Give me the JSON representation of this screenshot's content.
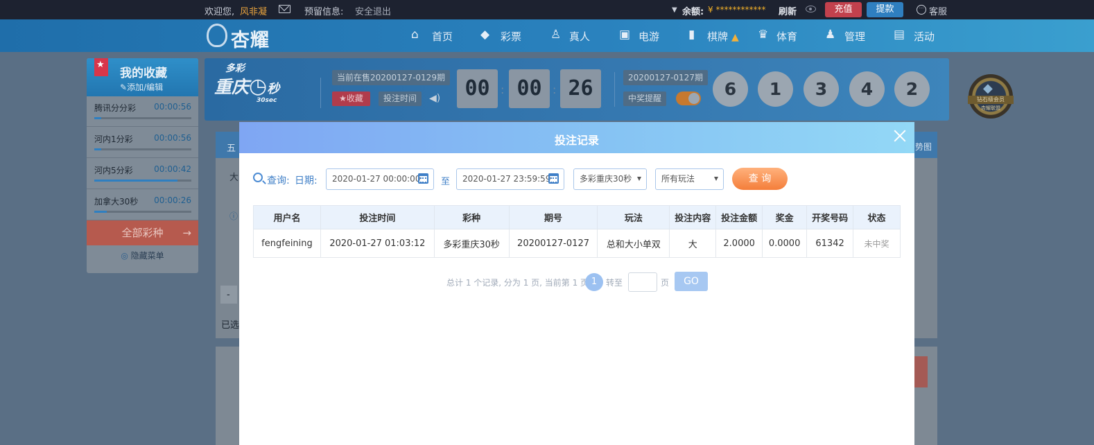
{
  "topbar": {
    "welcome": "欢迎您,",
    "username": "风非凝",
    "reserved_info": "预留信息:",
    "logout": "安全退出",
    "balance_label": "余额:",
    "balance_value": "¥ ************",
    "refresh": "刷新",
    "recharge": "充值",
    "withdraw": "提款",
    "service": "客服"
  },
  "nav": {
    "logo": "杏耀",
    "items": [
      {
        "label": "首页",
        "icon": "home-icon"
      },
      {
        "label": "彩票",
        "icon": "lottery-icon"
      },
      {
        "label": "真人",
        "icon": "live-dealer-icon"
      },
      {
        "label": "电游",
        "icon": "slot-machine-icon"
      },
      {
        "label": "棋牌",
        "icon": "cards-icon"
      },
      {
        "label": "体育",
        "icon": "trophy-icon"
      },
      {
        "label": "管理",
        "icon": "users-icon"
      },
      {
        "label": "活动",
        "icon": "gift-icon"
      }
    ]
  },
  "favorites": {
    "title": "我的收藏",
    "edit": "添加/编辑",
    "items": [
      {
        "name": "腾讯分分彩",
        "time": "00:00:56",
        "progress": 0.07
      },
      {
        "name": "河内1分彩",
        "time": "00:00:56",
        "progress": 0.07
      },
      {
        "name": "河内5分彩",
        "time": "00:00:42",
        "progress": 0.86
      },
      {
        "name": "加拿大30秒",
        "time": "00:00:26",
        "progress": 0.13
      }
    ],
    "all_lotteries": "全部彩种",
    "hide_menu": "隐藏菜单"
  },
  "lottery": {
    "logo_top": "多彩",
    "logo_main": "重庆",
    "logo_unit": "秒",
    "logo_sec": "30sec",
    "current_issue": "当前在售20200127-0129期",
    "collect": "收藏",
    "bet_time": "投注时间",
    "countdown": [
      "00",
      "00",
      "26"
    ],
    "last_issue": "20200127-0127期",
    "win_remind": "中奖提醒",
    "balls": [
      "6",
      "1",
      "3",
      "4",
      "2"
    ]
  },
  "vip_badge": {
    "line1": "钻石级会员",
    "line2": "杏耀联盟"
  },
  "background": {
    "tab_fragment": "五",
    "trend_fragment": "势图",
    "row_fragment": "大",
    "selected_fragment": "已选",
    "minus_fragment": "-"
  },
  "modal": {
    "title": "投注记录",
    "query_label": "查询:",
    "date_label": "日期:",
    "start_date": "2020-01-27 00:00:00",
    "to": "至",
    "end_date": "2020-01-27 23:59:59",
    "lottery_select": "多彩重庆30秒",
    "play_select": "所有玩法",
    "query_button": "查 询",
    "columns": [
      "用户名",
      "投注时间",
      "彩种",
      "期号",
      "玩法",
      "投注内容",
      "投注金额",
      "奖金",
      "开奖号码",
      "状态"
    ],
    "rows": [
      [
        "fengfeining",
        "2020-01-27 01:03:12",
        "多彩重庆30秒",
        "20200127-0127",
        "总和大小单双",
        "大",
        "2.0000",
        "0.0000",
        "61342",
        "未中奖"
      ]
    ],
    "pager_text": "总计 1 个记录, 分为 1 页, 当前第 1 页",
    "current_page": "1",
    "goto_label": "转至",
    "page_unit": "页",
    "go": "GO"
  }
}
